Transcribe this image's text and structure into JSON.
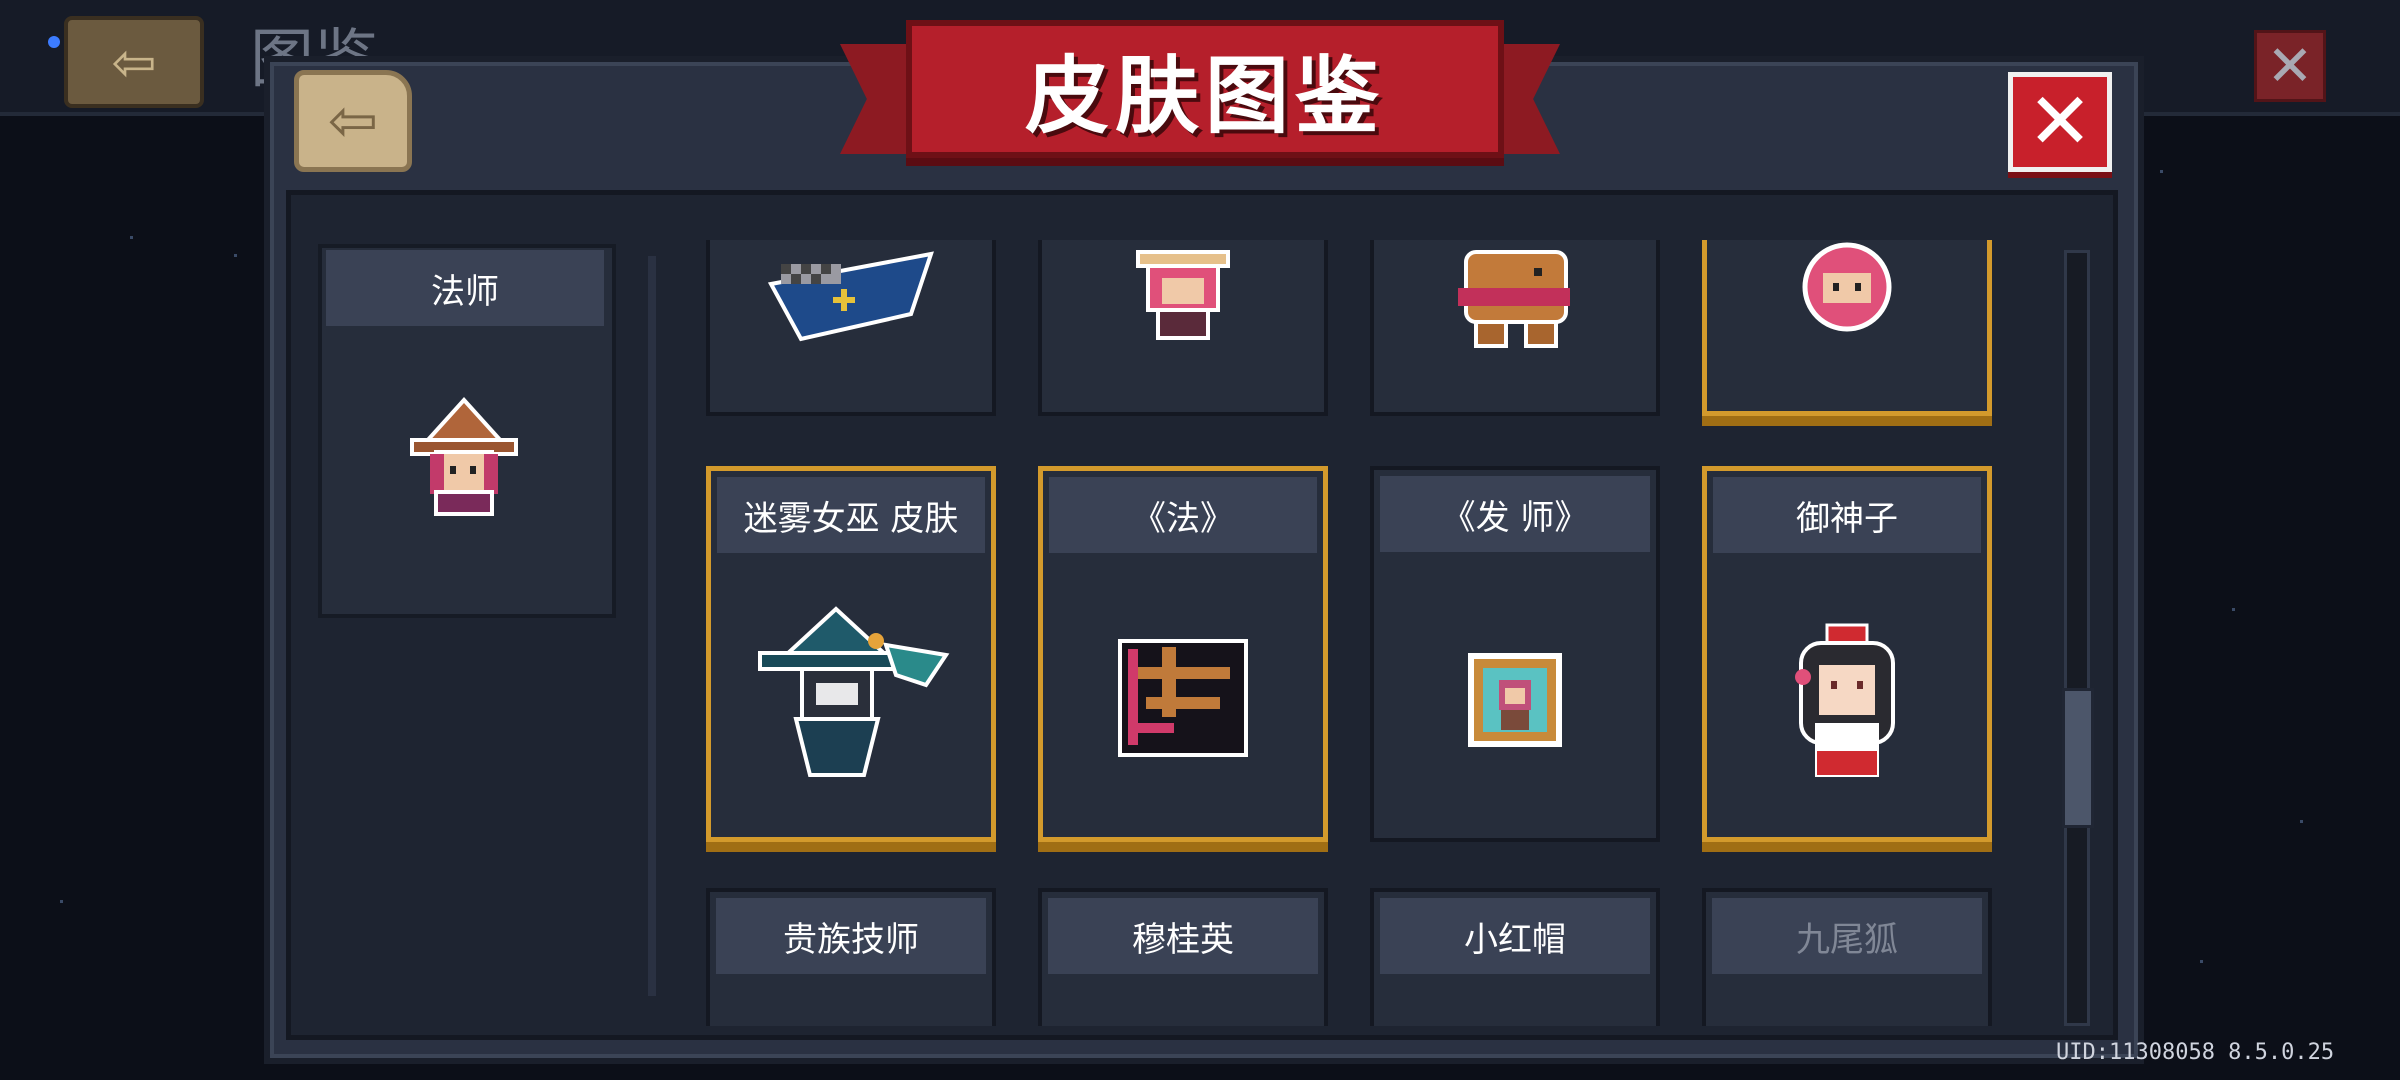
{
  "background_page": {
    "title": "图鉴",
    "back_icon": "exit-door-icon",
    "close_icon": "close-icon"
  },
  "modal": {
    "title": "皮肤图鉴",
    "back_icon": "exit-door-icon",
    "close_icon": "close-icon"
  },
  "category": {
    "label": "法师",
    "icon": "mage-witch-hat-sprite"
  },
  "skins": {
    "row_top": [
      {
        "label": "",
        "icon": "checkered-blue-cape-sprite",
        "highlighted": false
      },
      {
        "label": "",
        "icon": "pink-hair-girl-sprite",
        "highlighted": false
      },
      {
        "label": "",
        "icon": "capybara-sprite",
        "highlighted": false
      },
      {
        "label": "",
        "icon": "round-pink-head-sprite",
        "highlighted": true
      }
    ],
    "row_middle": [
      {
        "label": "迷雾女巫 皮肤",
        "icon": "mist-witch-sprite",
        "highlighted": true
      },
      {
        "label": "《法》",
        "icon": "fa-character-sprite",
        "highlighted": true
      },
      {
        "label": "《发 师》",
        "icon": "framed-portrait-sprite",
        "highlighted": false
      },
      {
        "label": "御神子",
        "icon": "shrine-maiden-sprite",
        "highlighted": true
      }
    ],
    "row_bottom": [
      {
        "label": "贵族技师",
        "highlighted": false,
        "locked": false
      },
      {
        "label": "穆桂英",
        "highlighted": false,
        "locked": false
      },
      {
        "label": "小红帽",
        "highlighted": false,
        "locked": false
      },
      {
        "label": "九尾狐",
        "highlighted": false,
        "locked": true
      }
    ]
  },
  "footer": {
    "uid_text": "UID:11308058 8.5.0.25"
  },
  "colors": {
    "gold_border": "#d39a2c",
    "ribbon_red": "#b51f2b",
    "close_red": "#c8202b"
  }
}
